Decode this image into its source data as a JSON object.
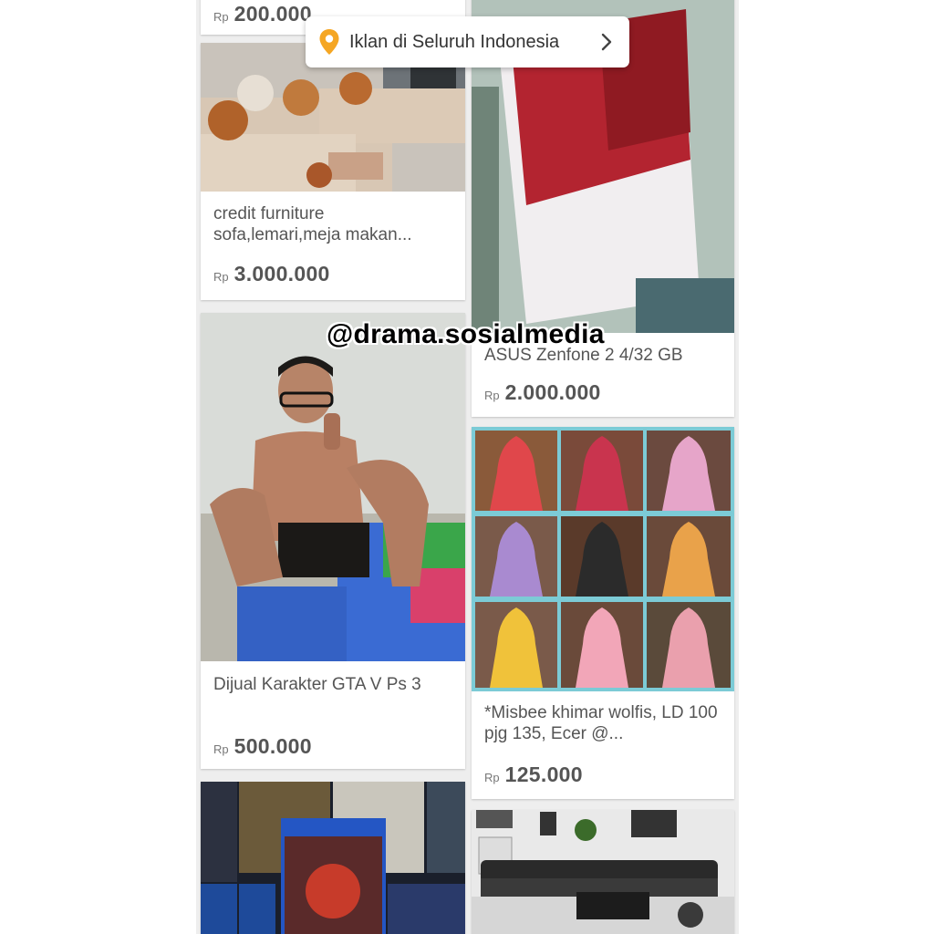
{
  "location_bar": {
    "label": "Iklan di Seluruh Indonesia"
  },
  "watermark": "@drama.sosialmedia",
  "currency": "Rp",
  "listings": [
    {
      "title": "",
      "price": "200.000"
    },
    {
      "title": "credit furniture sofa,lemari,meja makan...",
      "price": "3.000.000"
    },
    {
      "title": "ASUS Zenfone 2 4/32 GB",
      "price": "2.000.000"
    },
    {
      "title": "Dijual Karakter GTA V Ps 3",
      "price": "500.000"
    },
    {
      "title": "*Misbee khimar wolfis, LD 100 pjg 135, Ecer @...",
      "price": "125.000"
    },
    {
      "title": "",
      "price": ""
    },
    {
      "title": "",
      "price": ""
    }
  ],
  "colors": {
    "pin": "#f5a623",
    "price": "#555555",
    "background": "#eeeeee"
  },
  "icons": {
    "location": "location-pin-icon",
    "chevron": "chevron-right-icon"
  }
}
